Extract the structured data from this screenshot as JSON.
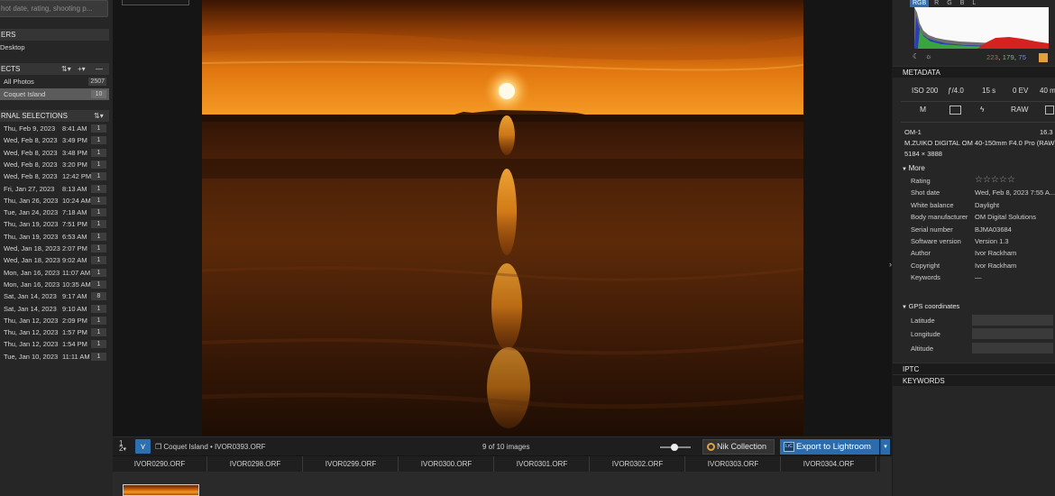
{
  "left": {
    "search_placeholder": "hot date, rating, shooting p...",
    "folders_header": "ERS",
    "folders": [
      {
        "label": "Desktop"
      }
    ],
    "projects_header": "ECTS",
    "projects_ctrl1": "⇅▾",
    "projects_ctrl2": "+▾",
    "projects_ctrl3": "—",
    "projects": [
      {
        "label": "All Photos",
        "count": "2507"
      },
      {
        "label": "Coquet Island",
        "count": "10"
      }
    ],
    "auto_header": "RNAL SELECTIONS",
    "auto_ctrl": "⇅▾",
    "selections": [
      {
        "date": "Thu, Feb 9, 2023",
        "time": "8:41 AM",
        "count": "1"
      },
      {
        "date": "Wed, Feb 8, 2023",
        "time": "3:49 PM",
        "count": "1"
      },
      {
        "date": "Wed, Feb 8, 2023",
        "time": "3:48 PM",
        "count": "1"
      },
      {
        "date": "Wed, Feb 8, 2023",
        "time": "3:20 PM",
        "count": "1"
      },
      {
        "date": "Wed, Feb 8, 2023",
        "time": "12:42 PM",
        "count": "1"
      },
      {
        "date": "Fri, Jan 27, 2023",
        "time": "8:13 AM",
        "count": "1"
      },
      {
        "date": "Thu, Jan 26, 2023",
        "time": "10:24 AM",
        "count": "1"
      },
      {
        "date": "Tue, Jan 24, 2023",
        "time": "7:18 AM",
        "count": "1"
      },
      {
        "date": "Thu, Jan 19, 2023",
        "time": "7:51 PM",
        "count": "1"
      },
      {
        "date": "Thu, Jan 19, 2023",
        "time": "6:53 AM",
        "count": "1"
      },
      {
        "date": "Wed, Jan 18, 2023",
        "time": "2:07 PM",
        "count": "1"
      },
      {
        "date": "Wed, Jan 18, 2023",
        "time": "9:02 AM",
        "count": "1"
      },
      {
        "date": "Mon, Jan 16, 2023",
        "time": "11:07 AM",
        "count": "1"
      },
      {
        "date": "Mon, Jan 16, 2023",
        "time": "10:35 AM",
        "count": "1"
      },
      {
        "date": "Sat, Jan 14, 2023",
        "time": "9:17 AM",
        "count": "8"
      },
      {
        "date": "Sat, Jan 14, 2023",
        "time": "9:10 AM",
        "count": "1"
      },
      {
        "date": "Thu, Jan 12, 2023",
        "time": "2:09 PM",
        "count": "1"
      },
      {
        "date": "Thu, Jan 12, 2023",
        "time": "1:57 PM",
        "count": "1"
      },
      {
        "date": "Thu, Jan 12, 2023",
        "time": "1:54 PM",
        "count": "1"
      },
      {
        "date": "Tue, Jan 10, 2023",
        "time": "11:11 AM",
        "count": "1"
      }
    ]
  },
  "toolbar": {
    "sort_icon": "sort-1-2-icon",
    "filter_icon": "filter-icon",
    "folder_icon": "folder-stack-icon",
    "breadcrumb": "Coquet Island  •  IVOR0393.ORF",
    "image_count": "9 of 10 images",
    "nik_label": "Nik Collection",
    "export_label": "Export to Lightroom",
    "export_icon_text": "LrC",
    "export_dropdown": "▾"
  },
  "filmstrip": {
    "names": [
      "IVOR0290.ORF",
      "IVOR0298.ORF",
      "IVOR0299.ORF",
      "IVOR0300.ORF",
      "IVOR0301.ORF",
      "IVOR0302.ORF",
      "IVOR0303.ORF",
      "IVOR0304.ORF"
    ]
  },
  "right": {
    "collapse_arrow": "›",
    "channel_tabs": [
      "RGB",
      "R",
      "G",
      "B",
      "L"
    ],
    "moon_icon": "☾",
    "sun_icon": "☼",
    "rgb_values": {
      "r": "223",
      "g": "179",
      "b": "75"
    },
    "metadata_header": "METADATA",
    "exposure": {
      "iso": "ISO 200",
      "aperture": "ƒ/4.0",
      "shutter": "15 s",
      "ev": "0 EV",
      "focal": "40 m"
    },
    "modes": {
      "mode": "M",
      "metering_icon": "metering-icon",
      "flash_icon": "flash-off-icon",
      "format": "RAW"
    },
    "camera": "OM-1",
    "megapixels": "16.3",
    "lens": "M.ZUIKO DIGITAL OM 40-150mm F4.0 Pro (RAW)",
    "dimensions": "5184 × 3888",
    "more_header": "More",
    "more": [
      {
        "k": "Rating",
        "v": "☆☆☆☆☆"
      },
      {
        "k": "Shot date",
        "v": "Wed, Feb 8, 2023 7:55 A..."
      },
      {
        "k": "White balance",
        "v": "Daylight"
      },
      {
        "k": "Body manufacturer",
        "v": "OM Digital Solutions"
      },
      {
        "k": "Serial number",
        "v": "BJMA03684"
      },
      {
        "k": "Software version",
        "v": "Version 1.3"
      },
      {
        "k": "Author",
        "v": "Ivor Rackham"
      },
      {
        "k": "Copyright",
        "v": "Ivor Rackham"
      },
      {
        "k": "Keywords",
        "v": "—"
      }
    ],
    "gps_header": "GPS coordinates",
    "gps": [
      {
        "k": "Latitude"
      },
      {
        "k": "Longitude"
      },
      {
        "k": "Altitude"
      }
    ],
    "iptc_header": "IPTC",
    "keywords_header": "KEYWORDS"
  }
}
